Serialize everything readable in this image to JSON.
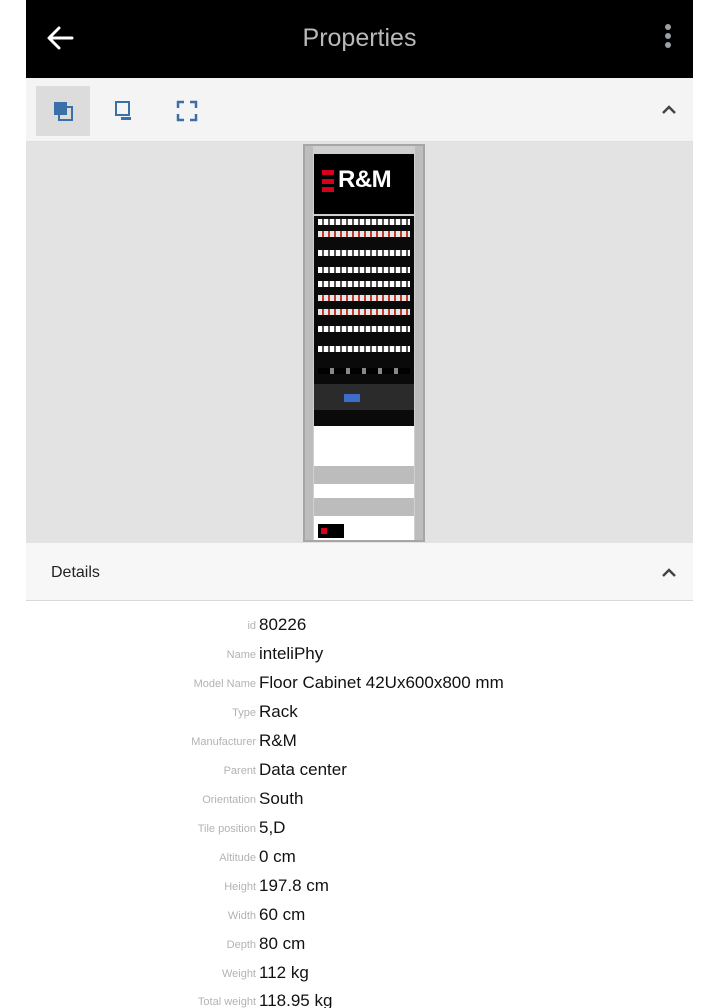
{
  "header": {
    "title": "Properties"
  },
  "toolbar": {
    "views": [
      "front-view",
      "rear-view",
      "fullscreen-view"
    ]
  },
  "rack_preview": {
    "brand": "R&M"
  },
  "details": {
    "section_label": "Details",
    "properties": [
      {
        "key": "id",
        "value": "80226"
      },
      {
        "key": "Name",
        "value": "inteliPhy"
      },
      {
        "key": "Model Name",
        "value": "Floor Cabinet 42Ux600x800 mm"
      },
      {
        "key": "Type",
        "value": "Rack"
      },
      {
        "key": "Manufacturer",
        "value": "R&M"
      },
      {
        "key": "Parent",
        "value": "Data center"
      },
      {
        "key": "Orientation",
        "value": "South"
      },
      {
        "key": "Tile position",
        "value": "5,D"
      },
      {
        "key": "Altitude",
        "value": "0 cm"
      },
      {
        "key": "Height",
        "value": "197.8 cm"
      },
      {
        "key": "Width",
        "value": "60 cm"
      },
      {
        "key": "Depth",
        "value": "80 cm"
      },
      {
        "key": "Weight",
        "value": "112 kg"
      },
      {
        "key": "Total weight",
        "value": "118.95 kg"
      }
    ]
  },
  "colors": {
    "appbar_bg": "#000000",
    "title": "#b9b9b9",
    "brand_red": "#d6001c",
    "label_grey": "#b3b3b3"
  }
}
